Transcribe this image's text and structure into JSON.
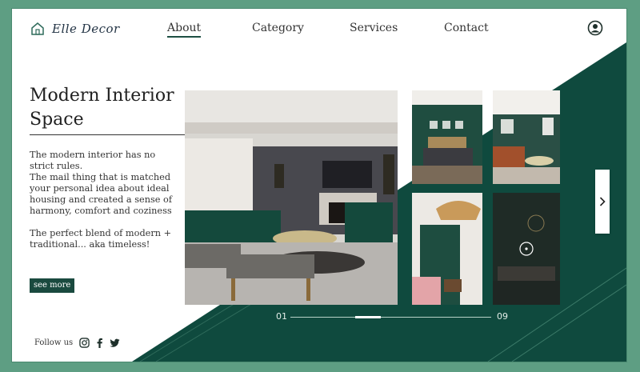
{
  "brand": {
    "name": "Elle Decor",
    "accent": "#0f4a3e",
    "background": "#5e9e83"
  },
  "nav": {
    "items": [
      {
        "label": "About",
        "active": true
      },
      {
        "label": "Category",
        "active": false
      },
      {
        "label": "Services",
        "active": false
      },
      {
        "label": "Contact",
        "active": false
      }
    ]
  },
  "hero": {
    "title": "Modern Interior Space",
    "description_1": "The modern interior has no strict rules.",
    "description_2": "The mail thing that is matched your personal idea about ideal housing and created a sense of harmony, comfort and coziness",
    "description_3": "The perfect blend of modern + traditional... aka timeless!",
    "cta_label": "see more"
  },
  "social": {
    "label": "Follow us",
    "icons": [
      "instagram-icon",
      "facebook-icon",
      "twitter-icon"
    ]
  },
  "gallery": {
    "current_page": "01",
    "total_pages": "09",
    "next_icon": "chevron-right-icon"
  }
}
